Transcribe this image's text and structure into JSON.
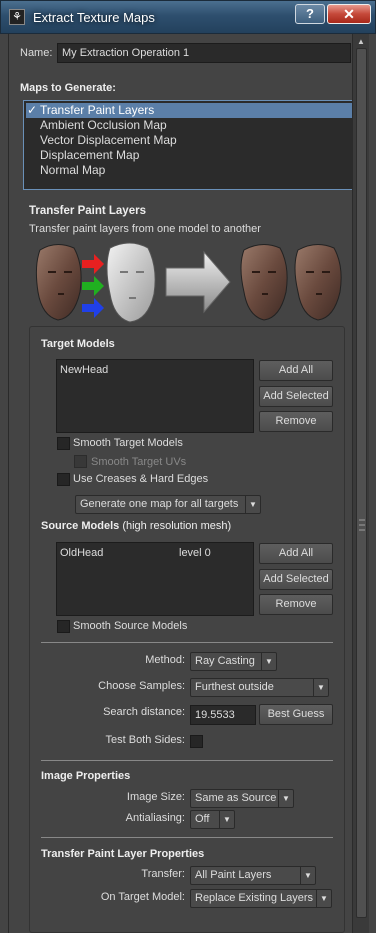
{
  "window": {
    "title": "Extract Texture Maps",
    "help_label": "?",
    "close_label": "✕"
  },
  "name_field": {
    "label": "Name:",
    "value": "My Extraction Operation 1"
  },
  "maps_to_generate": {
    "heading": "Maps to Generate:",
    "items": [
      {
        "label": "Transfer Paint Layers",
        "checked": true,
        "selected": true
      },
      {
        "label": "Ambient Occlusion Map",
        "checked": false,
        "selected": false
      },
      {
        "label": "Vector Displacement Map",
        "checked": false,
        "selected": false
      },
      {
        "label": "Displacement Map",
        "checked": false,
        "selected": false
      },
      {
        "label": "Normal Map",
        "checked": false,
        "selected": false
      }
    ],
    "check_glyph": "✓"
  },
  "section": {
    "title": "Transfer Paint Layers",
    "description": "Transfer paint layers from one model to another"
  },
  "target_models": {
    "heading": "Target Models",
    "items": [
      {
        "name": "NewHead"
      }
    ],
    "add_all": "Add All",
    "add_selected": "Add Selected",
    "remove": "Remove",
    "smooth_target_models": "Smooth Target Models",
    "smooth_target_uvs": "Smooth Target UVs",
    "use_creases": "Use Creases & Hard Edges",
    "map_mode": "Generate one map for all targets"
  },
  "source_models": {
    "heading": "Source Models",
    "heading_note": "(high resolution mesh)",
    "items": [
      {
        "name": "OldHead",
        "level": "level 0"
      }
    ],
    "add_all": "Add All",
    "add_selected": "Add Selected",
    "remove": "Remove",
    "smooth_source_models": "Smooth Source Models"
  },
  "sampling": {
    "method_label": "Method:",
    "method_value": "Ray Casting",
    "choose_samples_label": "Choose Samples:",
    "choose_samples_value": "Furthest outside",
    "search_distance_label": "Search distance:",
    "search_distance_value": "19.5533",
    "best_guess": "Best Guess",
    "test_both_sides_label": "Test Both Sides:"
  },
  "image_properties": {
    "heading": "Image Properties",
    "image_size_label": "Image Size:",
    "image_size_value": "Same as Source",
    "antialiasing_label": "Antialiasing:",
    "antialiasing_value": "Off"
  },
  "transfer_properties": {
    "heading": "Transfer Paint Layer Properties",
    "transfer_label": "Transfer:",
    "transfer_value": "All Paint Layers",
    "on_target_label": "On Target Model:",
    "on_target_value": "Replace Existing Layers"
  },
  "icons": {
    "dropdown_arrow": "▼",
    "scroll_up": "▲"
  }
}
